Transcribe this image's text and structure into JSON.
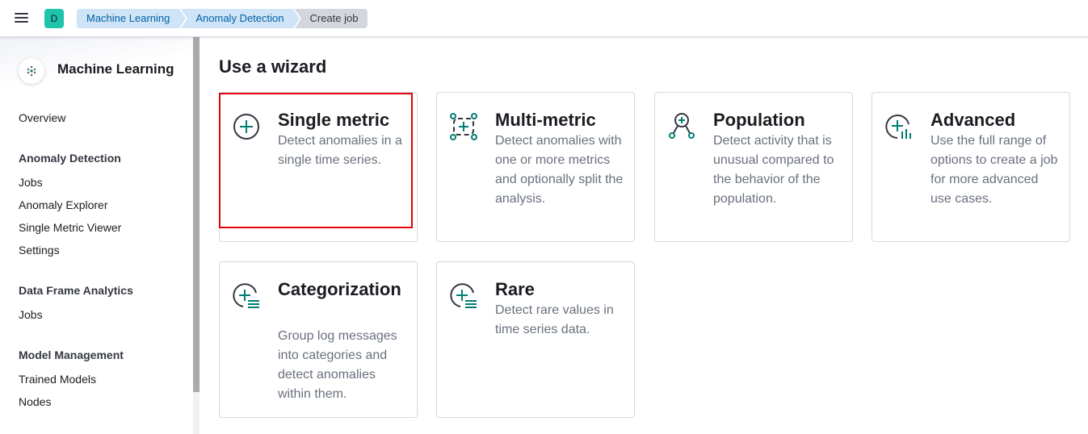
{
  "header": {
    "space_avatar": "D",
    "breadcrumbs": [
      "Machine Learning",
      "Anomaly Detection",
      "Create job"
    ]
  },
  "sidebar": {
    "title": "Machine Learning",
    "overview": "Overview",
    "sections": [
      {
        "heading": "Anomaly Detection",
        "items": [
          "Jobs",
          "Anomaly Explorer",
          "Single Metric Viewer",
          "Settings"
        ]
      },
      {
        "heading": "Data Frame Analytics",
        "items": [
          "Jobs"
        ]
      },
      {
        "heading": "Model Management",
        "items": [
          "Trained Models",
          "Nodes"
        ]
      }
    ]
  },
  "main": {
    "title": "Use a wizard",
    "cards": [
      {
        "title": "Single metric",
        "description": "Detect anomalies in a single time series.",
        "icon": "single-metric-icon"
      },
      {
        "title": "Multi-metric",
        "description": "Detect anomalies with one or more metrics and optionally split the analysis.",
        "icon": "multi-metric-icon"
      },
      {
        "title": "Population",
        "description": "Detect activity that is unusual compared to the behavior of the population.",
        "icon": "population-icon"
      },
      {
        "title": "Advanced",
        "description": "Use the full range of options to create a job for more advanced use cases.",
        "icon": "advanced-icon"
      },
      {
        "title": "Categorization",
        "description": "Group log messages into categories and detect anomalies within them.",
        "icon": "categorization-icon"
      },
      {
        "title": "Rare",
        "description": "Detect rare values in time series data.",
        "icon": "rare-icon"
      }
    ]
  },
  "colors": {
    "accent": "#017d73",
    "highlight": "#e7000b",
    "breadcrumb_bg": "#cfe4f7"
  }
}
